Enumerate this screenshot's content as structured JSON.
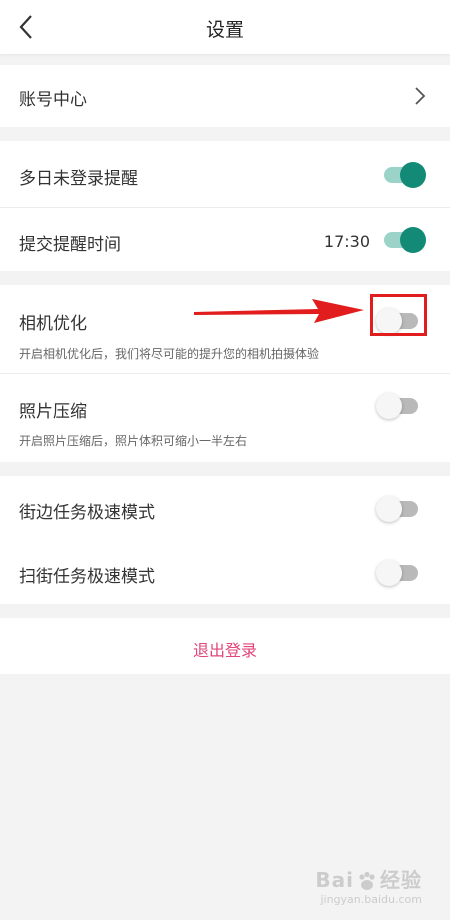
{
  "nav": {
    "title": "设置",
    "back_icon": "chevron-left-icon"
  },
  "account": {
    "label": "账号中心",
    "icon": "chevron-right-icon"
  },
  "reminders": {
    "multi_day": {
      "label": "多日未登录提醒",
      "toggle_on": true
    },
    "submit_time": {
      "label": "提交提醒时间",
      "time": "17:30",
      "toggle_on": true
    }
  },
  "camera": {
    "camera_opt": {
      "label": "相机优化",
      "desc": "开启相机优化后，我们将尽可能的提升您的相机拍摄体验",
      "toggle_on": false
    },
    "photo_compress": {
      "label": "照片压缩",
      "desc": "开启照片压缩后，照片体积可缩小一半左右",
      "toggle_on": false
    }
  },
  "modes": {
    "street_task": {
      "label": "街边任务极速模式",
      "toggle_on": false
    },
    "scan_task": {
      "label": "扫街任务极速模式",
      "toggle_on": false
    }
  },
  "logout": {
    "label": "退出登录"
  },
  "watermark": {
    "line1": "Bai",
    "line1b": "经验",
    "line2": "jingyan.baidu.com"
  },
  "colors": {
    "accent": "#128a75",
    "accent_track": "#9cd3c9",
    "logout_text": "#e0457b",
    "annotation": "#e21d1d",
    "background": "#f3f3f3"
  }
}
